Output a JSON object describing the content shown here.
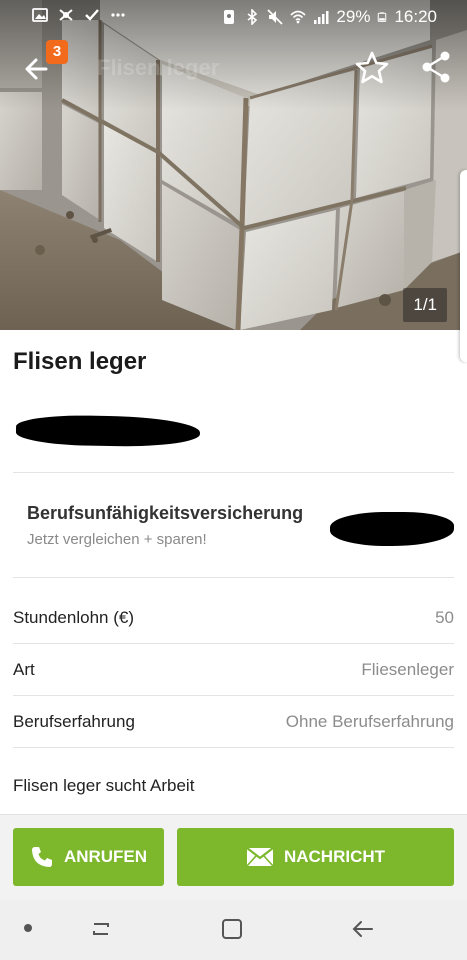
{
  "status_bar": {
    "battery": "29%",
    "time": "16:20",
    "left_icons": [
      "image-icon",
      "app-icon",
      "check-icon",
      "more-icon"
    ],
    "right_icons": [
      "sim-icon",
      "bluetooth-icon",
      "mute-icon",
      "wifi-icon",
      "signal-icon",
      "battery-icon"
    ]
  },
  "header": {
    "badge_count": "3",
    "ghost_title": "Flisen leger",
    "image_counter": "1/1"
  },
  "listing": {
    "title": "Flisen leger"
  },
  "ad": {
    "title": "Berufsunfähigkeitsversicherung",
    "subtitle": "Jetzt vergleichen + sparen!"
  },
  "details": [
    {
      "label": "Stundenlohn (€)",
      "value": "50"
    },
    {
      "label": "Art",
      "value": "Fliesenleger"
    },
    {
      "label": "Berufserfahrung",
      "value": "Ohne Berufserfahrung"
    }
  ],
  "description": "Flisen leger sucht Arbeit",
  "actions": {
    "call_label": "ANRUFEN",
    "message_label": "NACHRICHT"
  },
  "colors": {
    "accent_green": "#7cb72c",
    "badge_orange": "#f26b1d"
  }
}
